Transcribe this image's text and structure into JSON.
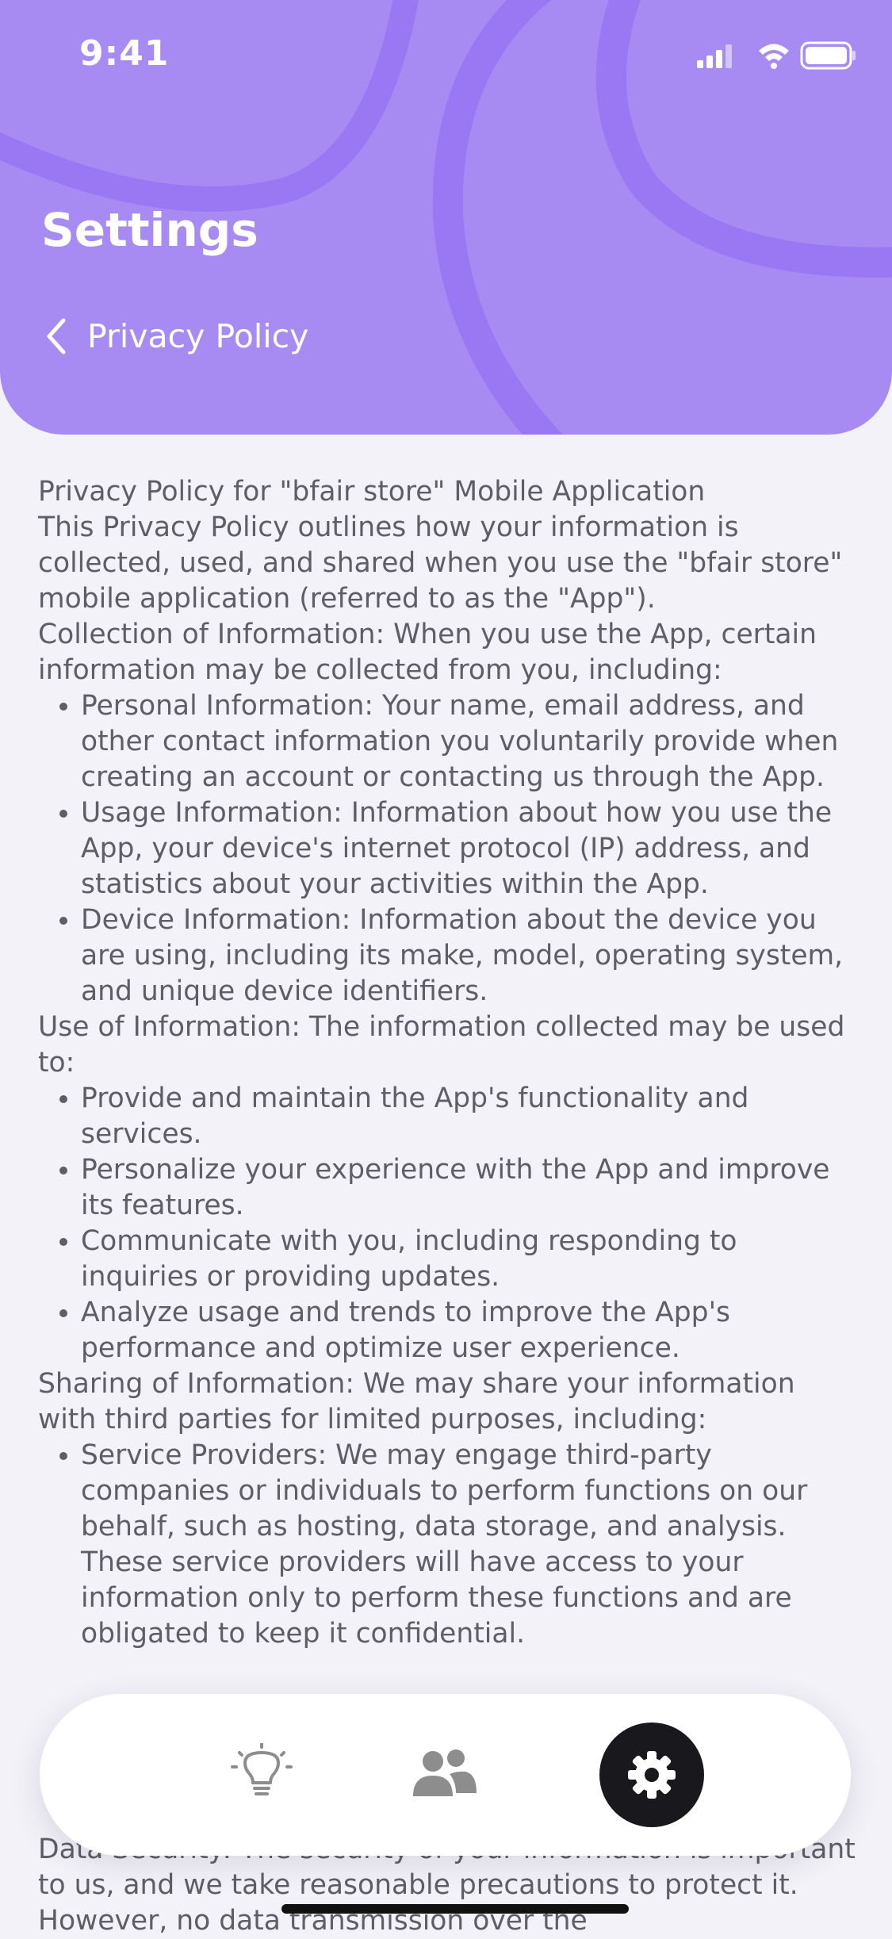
{
  "status_bar": {
    "time": "9:41"
  },
  "header": {
    "title": "Settings",
    "back_label": "Privacy Policy"
  },
  "colors": {
    "header_bg": "#a78bf2",
    "header_arc": "#9a78f3",
    "page_bg": "#f3f2f8",
    "text": "#5f5d66",
    "active_tab": "#19181d",
    "inactive_icon": "#8d8d8d"
  },
  "policy": {
    "p1": "Privacy Policy for \"bfair store\" Mobile Application",
    "p2": "This Privacy Policy outlines how your information is collected, used, and shared when you use the \"bfair store\" mobile application (referred to as the \"App\").",
    "p3": "Collection of Information: When you use the App, certain information may be collected from you, including:",
    "collection": [
      "Personal Information: Your name, email address, and other contact information you voluntarily provide when creating an account or contacting us through the App.",
      "Usage Information: Information about how you use the App, your device's internet protocol (IP) address, and statistics about your activities within the App.",
      "Device Information: Information about the device you are using, including its make, model, operating system, and unique device identifiers."
    ],
    "p4": "Use of Information: The information collected may be used to:",
    "use": [
      "Provide and maintain the App's functionality and services.",
      "Personalize your experience with the App and improve its features.",
      "Communicate with you, including responding to inquiries or providing updates.",
      "Analyze usage and trends to improve the App's performance and optimize user experience."
    ],
    "p5": "Sharing of Information: We may share your information with third parties for limited purposes, including:",
    "sharing": [
      "Service Providers: We may engage third-party companies or individuals to perform functions on our behalf, such as hosting, data storage, and analysis. These service providers will have access to your information only to perform these functions and are obligated to keep it confidential."
    ],
    "p6": "Data Security: The security of your information is important to us, and we take reasonable precautions to protect it. However, no data transmission over the"
  },
  "tabs": [
    {
      "icon": "lightbulb-icon",
      "active": false
    },
    {
      "icon": "users-icon",
      "active": false
    },
    {
      "icon": "gear-icon",
      "active": true
    }
  ]
}
